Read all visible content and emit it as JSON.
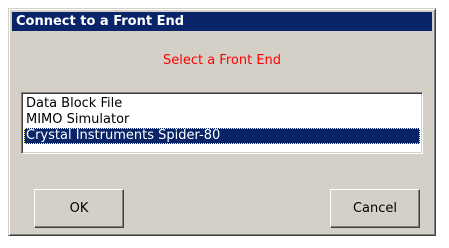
{
  "window": {
    "title": "Connect to a Front End"
  },
  "prompt": {
    "text": "Select a Front End",
    "color": "#ff0000"
  },
  "listbox": {
    "items": [
      {
        "label": "Data Block File",
        "selected": false
      },
      {
        "label": "MIMO Simulator",
        "selected": false
      },
      {
        "label": "Crystal Instruments Spider-80",
        "selected": true
      }
    ]
  },
  "buttons": {
    "ok_label": "OK",
    "cancel_label": "Cancel"
  },
  "colors": {
    "titlebar": "#0a246a",
    "dialog_face": "#d4d0c8",
    "selection": "#0a246a"
  }
}
